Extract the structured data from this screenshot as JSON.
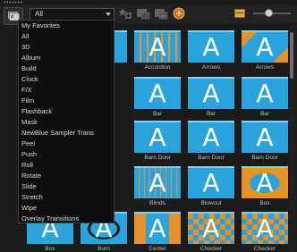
{
  "category_select": {
    "value": "All"
  },
  "category_options": [
    "My Favorites",
    "All",
    "3D",
    "Album",
    "Build",
    "Clock",
    "F/X",
    "Film",
    "Flashback",
    "Mask",
    "NewBlue Sampler Trans",
    "Peel",
    "Push",
    "Roll",
    "Rotate",
    "Slide",
    "Stretch",
    "Wipe",
    "Overlay Transitions"
  ],
  "tiles": [
    {
      "label": "",
      "glyph": "A"
    },
    {
      "label": "Accordion",
      "glyph": "A"
    },
    {
      "label": "Arrows",
      "glyph": "A"
    },
    {
      "label": "Arrows",
      "glyph": "A"
    },
    {
      "label": "Bar",
      "glyph": "A"
    },
    {
      "label": "Bar",
      "glyph": "A"
    },
    {
      "label": "Bar",
      "glyph": "A"
    },
    {
      "label": "Barn Door",
      "glyph": "A"
    },
    {
      "label": "Barn Door",
      "glyph": "A"
    },
    {
      "label": "Barn Door",
      "glyph": "A"
    },
    {
      "label": "Blinds",
      "glyph": "A"
    },
    {
      "label": "Blowout",
      "glyph": "A"
    },
    {
      "label": "Box",
      "glyph": "A"
    },
    {
      "label": "Box",
      "glyph": "A"
    },
    {
      "label": "Burn",
      "glyph": "A"
    },
    {
      "label": "Center",
      "glyph": "A"
    },
    {
      "label": "Checker",
      "glyph": "A"
    },
    {
      "label": "Checker",
      "glyph": "A"
    }
  ],
  "icons": {
    "library": "library-icon",
    "add_favorite": "add-favorite-icon",
    "apply_video": "apply-video-track-icon",
    "apply_audio": "apply-audio-track-icon",
    "get_more": "get-more-content-icon",
    "view_toggle": "thumbnail-view-icon",
    "zoom_slider": "thumbnail-size-slider"
  },
  "colors": {
    "thumb_blue": "#2aa2dc",
    "thumb_orange": "#e8902a",
    "toggle_yellow": "#d9b233"
  }
}
